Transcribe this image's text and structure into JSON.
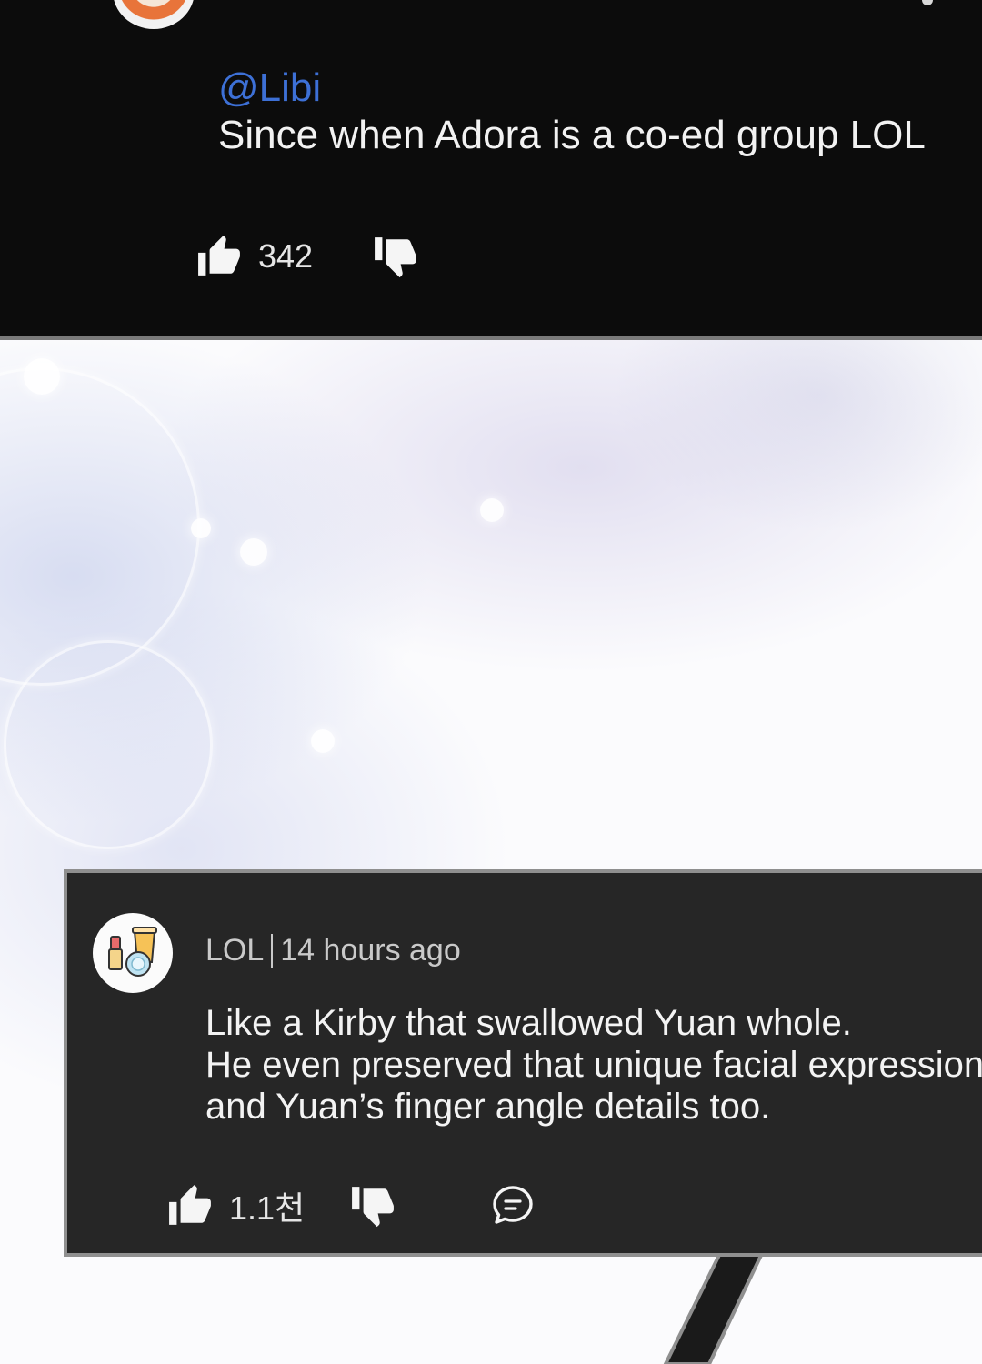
{
  "top_reply": {
    "mention": "@Libi",
    "text": "Since when Adora is a co-ed group LOL",
    "like_count": "342",
    "icons": {
      "like": "thumbs-up-icon",
      "dislike": "thumbs-down-icon"
    }
  },
  "comment": {
    "username": "LOL",
    "time": "14 hours ago",
    "body_lines": [
      "Like a Kirby that swallowed Yuan whole.",
      "He even preserved that unique facial expression",
      "and Yuan’s finger angle details too."
    ],
    "like_count": "1.1천",
    "icons": {
      "like": "thumbs-up-icon",
      "dislike": "thumbs-down-icon",
      "reply": "chat-bubble-icon",
      "avatar": "cosmetics-icon"
    }
  },
  "colors": {
    "panel_black": "#0c0c0c",
    "card_bg": "#262626",
    "mention_blue": "#3d70d6",
    "text_light": "#f2f2f2",
    "meta_gray": "#c9c9c9"
  }
}
